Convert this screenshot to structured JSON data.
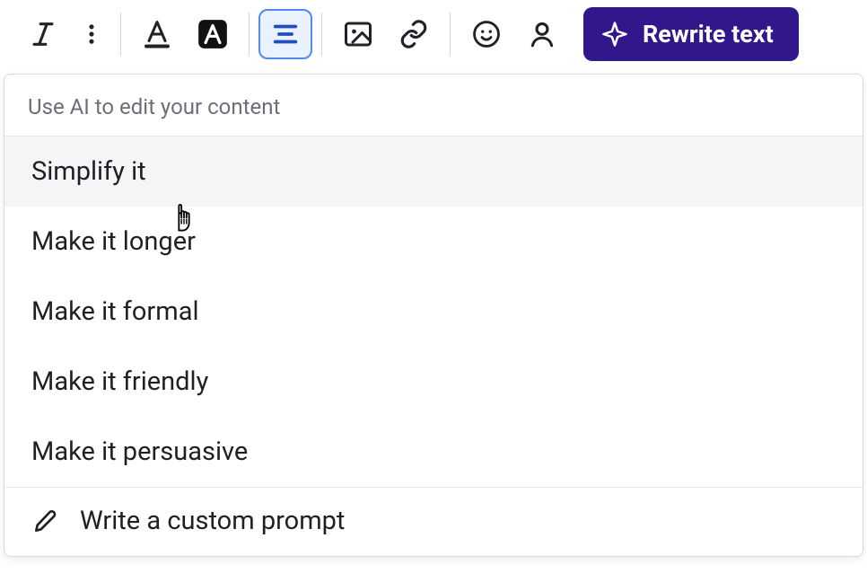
{
  "toolbar": {
    "rewrite_label": "Rewrite text"
  },
  "menu": {
    "header": "Use AI to edit your content",
    "items": [
      "Simplify it",
      "Make it longer",
      "Make it formal",
      "Make it friendly",
      "Make it persuasive"
    ],
    "footer": "Write a custom prompt"
  }
}
